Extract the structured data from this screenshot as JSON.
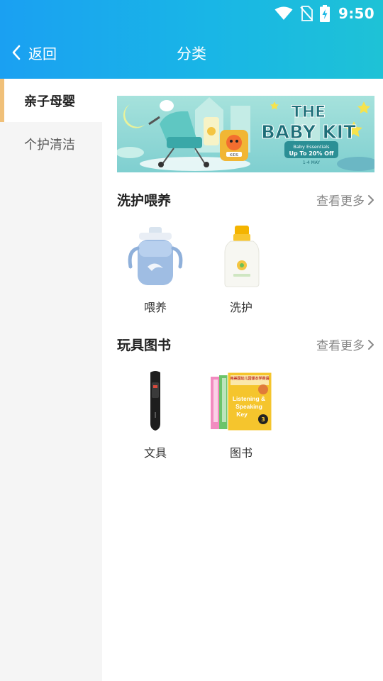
{
  "status_bar": {
    "time": "9:50"
  },
  "header": {
    "back_label": "返回",
    "title": "分类"
  },
  "sidebar": {
    "items": [
      {
        "label": "亲子母婴",
        "active": true
      },
      {
        "label": "个护清洁",
        "active": false
      }
    ]
  },
  "banner": {
    "line1": "THE",
    "line2": "BABY KIT",
    "sub": "Baby Essentials",
    "offer": "Up To 20% Off",
    "date": "1-4 MAY",
    "bag_text": "KIDS"
  },
  "sections": [
    {
      "title": "洗护喂养",
      "more": "查看更多",
      "items": [
        {
          "label": "喂养"
        },
        {
          "label": "洗护"
        }
      ]
    },
    {
      "title": "玩具图书",
      "more": "查看更多",
      "items": [
        {
          "label": "文具"
        },
        {
          "label": "图书"
        }
      ]
    }
  ],
  "book_cover": {
    "title_cn": "用美国幼儿园课本学英语",
    "title_en": [
      "Listening &",
      "Speaking",
      "Key"
    ],
    "number": "3"
  }
}
